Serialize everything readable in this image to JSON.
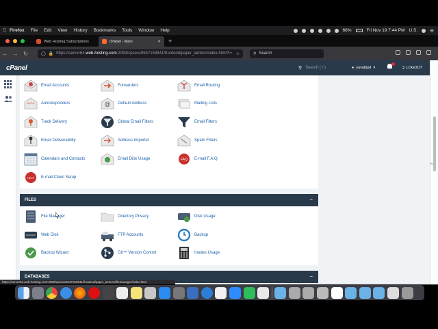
{
  "menubar": {
    "app": "Firefox",
    "items": [
      "File",
      "Edit",
      "View",
      "History",
      "Bookmarks",
      "Tools",
      "Window",
      "Help"
    ],
    "battery": "66%",
    "datetime": "Fri Nov 19  7:44 PM",
    "locale": "U.S."
  },
  "tabs": [
    {
      "label": "Web Hosting Subscriptions",
      "active": false
    },
    {
      "label": "cPanel - Main",
      "active": true
    }
  ],
  "newtab_label": "+",
  "urlbar": {
    "prefix": "https://server64.",
    "host": "web-hosting.com",
    "rest": ":2083/cpsess9947159941/frontend/paper_lantern/index.html?l=",
    "lock_icon": "lock-icon"
  },
  "searchbar": {
    "placeholder": "Search"
  },
  "cpanel": {
    "logo": "cPanel",
    "search_placeholder": "Search ( / )",
    "username": "yuvabipd",
    "logout_label": "LOGOUT",
    "brand_color": "#293a4a"
  },
  "email_section": {
    "items": [
      {
        "label": "Email Accounts",
        "icon": "mail-icon"
      },
      {
        "label": "Forwarders",
        "icon": "forward-mail-icon"
      },
      {
        "label": "Email Routing",
        "icon": "routing-icon"
      },
      {
        "label": "Autoresponders",
        "icon": "auto-mail-icon"
      },
      {
        "label": "Default Address",
        "icon": "at-sign-icon"
      },
      {
        "label": "Mailing Lists",
        "icon": "mailing-list-icon"
      },
      {
        "label": "Track Delivery",
        "icon": "track-icon"
      },
      {
        "label": "Global Email Filters",
        "icon": "globe-filter-icon"
      },
      {
        "label": "Email Filters",
        "icon": "funnel-icon"
      },
      {
        "label": "Email Deliverability",
        "icon": "key-mail-icon"
      },
      {
        "label": "Address Importer",
        "icon": "import-icon"
      },
      {
        "label": "Spam Filters",
        "icon": "spam-filter-icon"
      },
      {
        "label": "Calendars and Contacts",
        "icon": "calendar-icon"
      },
      {
        "label": "Email Disk Usage",
        "icon": "disk-mail-icon"
      },
      {
        "label": "E-mail F.A.Q.",
        "icon": "faq-icon"
      },
      {
        "label": "E-mail Client Setup",
        "icon": "client-setup-icon"
      }
    ]
  },
  "files_section": {
    "title": "FILES",
    "collapse": "−",
    "items": [
      {
        "label": "File Manager",
        "icon": "file-manager-icon"
      },
      {
        "label": "Directory Privacy",
        "icon": "folder-lock-icon"
      },
      {
        "label": "Disk Usage",
        "icon": "disk-usage-icon"
      },
      {
        "label": "Web Disk",
        "icon": "web-disk-icon"
      },
      {
        "label": "FTP Accounts",
        "icon": "ftp-icon"
      },
      {
        "label": "Backup",
        "icon": "backup-icon"
      },
      {
        "label": "Backup Wizard",
        "icon": "backup-wizard-icon"
      },
      {
        "label": "Git™ Version Control",
        "icon": "git-icon"
      },
      {
        "label": "Inodes Usage",
        "icon": "inodes-icon"
      }
    ]
  },
  "databases_section": {
    "title": "DATABASES",
    "collapse": "−"
  },
  "edge_text": "oo",
  "statusbar_url": "https://server64.web-hosting.com:2083/cpsess9947159941/frontend/paper_lantern/filemanager/index.html"
}
